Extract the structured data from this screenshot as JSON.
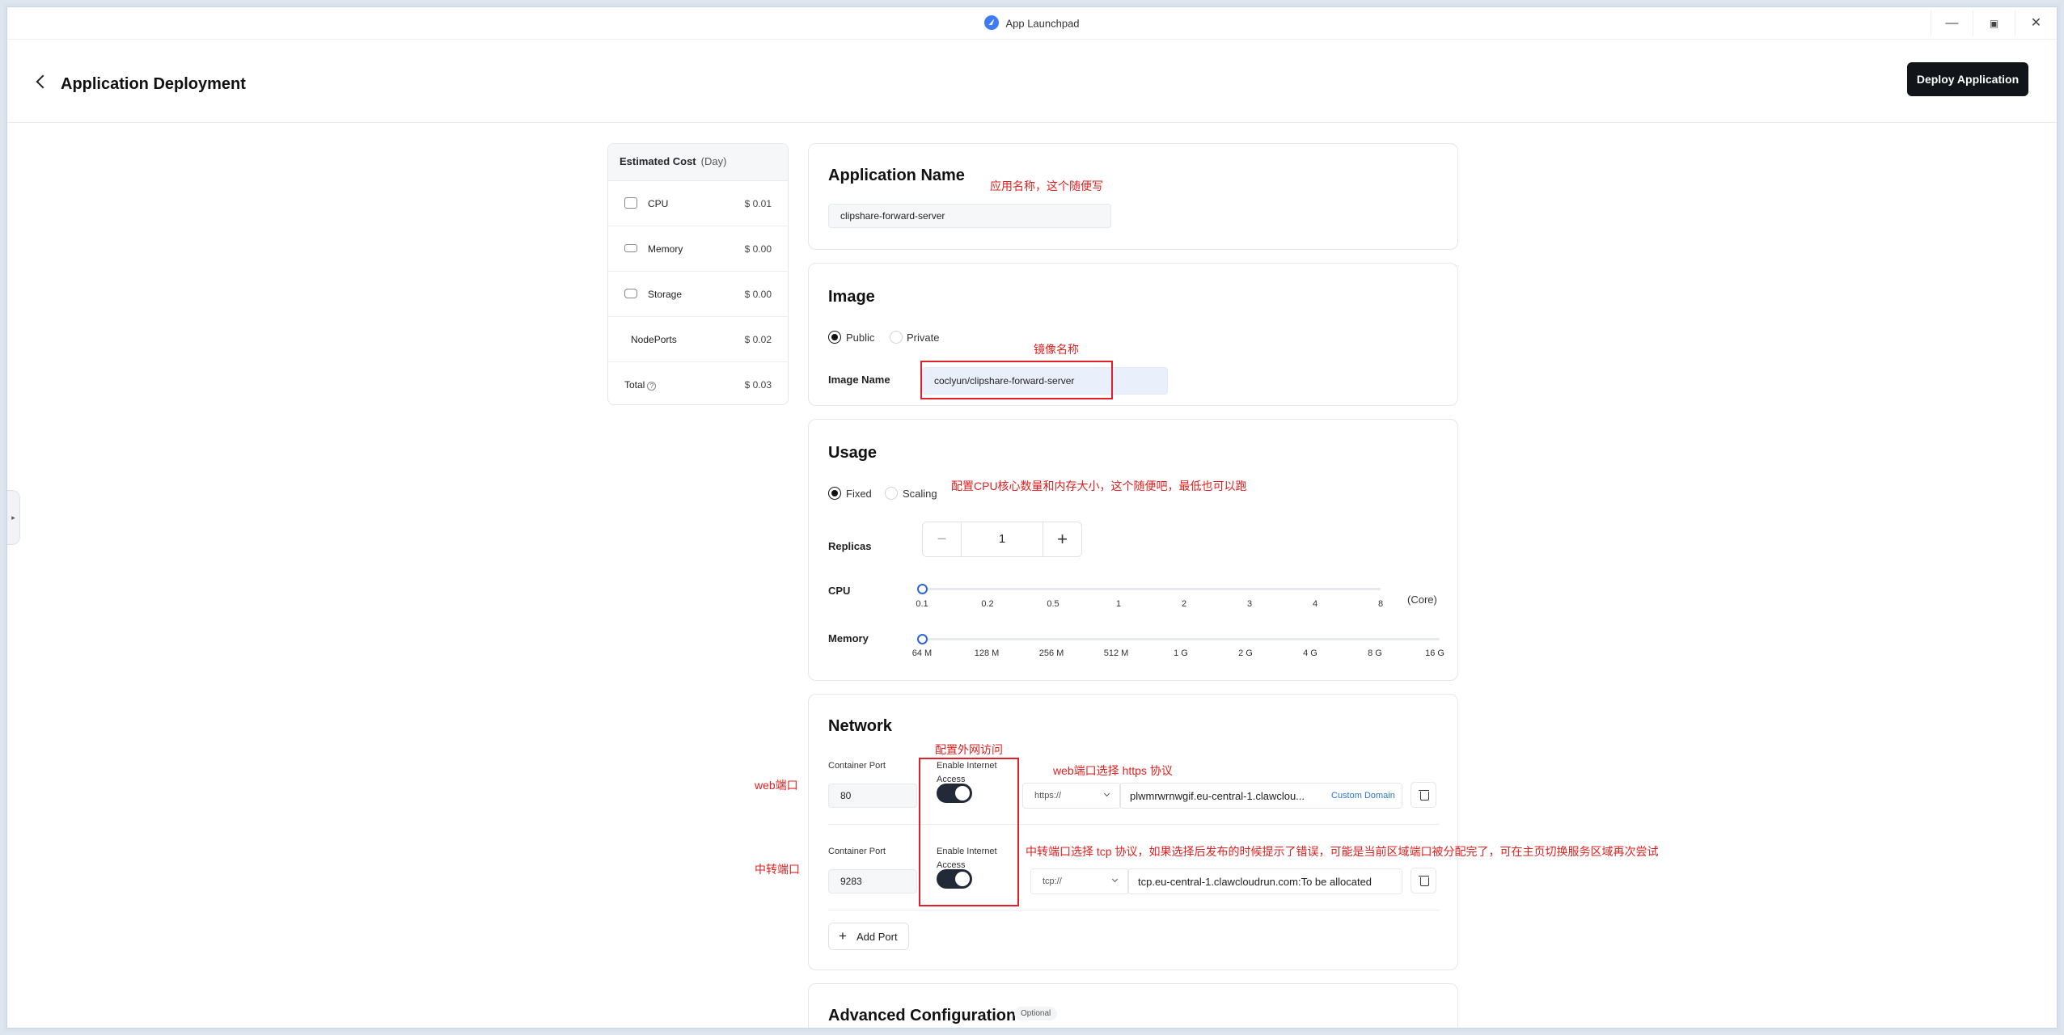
{
  "window": {
    "title": "App Launchpad",
    "controls": {
      "minimize": "—",
      "maximize": "▣",
      "close": "✕"
    }
  },
  "header": {
    "page_title": "Application Deployment",
    "deploy_button": "Deploy Application"
  },
  "cost": {
    "title": "Estimated Cost",
    "period": "(Day)",
    "rows": [
      {
        "label": "CPU",
        "value": "$ 0.01",
        "icon": "cpu-icon"
      },
      {
        "label": "Memory",
        "value": "$ 0.00",
        "icon": "memory-icon"
      },
      {
        "label": "Storage",
        "value": "$ 0.00",
        "icon": "storage-icon"
      },
      {
        "label": "NodePorts",
        "value": "$ 0.02"
      },
      {
        "label": "Total",
        "value": "$ 0.03"
      }
    ]
  },
  "app_name": {
    "title": "Application Name",
    "value": "clipshare-forward-server"
  },
  "image": {
    "title": "Image",
    "option_public": "Public",
    "option_private": "Private",
    "selected": "Public",
    "name_label": "Image Name",
    "name_value": "coclyun/clipshare-forward-server"
  },
  "usage": {
    "title": "Usage",
    "option_fixed": "Fixed",
    "option_scaling": "Scaling",
    "selected": "Fixed",
    "replicas_label": "Replicas",
    "replicas_value": "1",
    "cpu_label": "CPU",
    "cpu_unit": "(Core)",
    "cpu_ticks": [
      "0.1",
      "0.2",
      "0.5",
      "1",
      "2",
      "3",
      "4",
      "8"
    ],
    "cpu_selected": "0.1",
    "memory_label": "Memory",
    "memory_ticks": [
      "64 M",
      "128 M",
      "256 M",
      "512 M",
      "1 G",
      "2 G",
      "4 G",
      "8 G",
      "16 G"
    ],
    "memory_selected": "64 M"
  },
  "network": {
    "title": "Network",
    "ports": [
      {
        "container_port_label": "Container Port",
        "port": "80",
        "internet_label": "Enable Internet Access",
        "internet_enabled": true,
        "protocol": "https://",
        "domain": "plwmrwrnwgif.eu-central-1.clawclou...",
        "custom_domain": "Custom Domain"
      },
      {
        "container_port_label": "Container Port",
        "port": "9283",
        "internet_label": "Enable Internet Access",
        "internet_enabled": true,
        "protocol": "tcp://",
        "domain": "tcp.eu-central-1.clawcloudrun.com:To be allocated"
      }
    ],
    "add_port": "Add Port"
  },
  "advanced": {
    "title": "Advanced Configuration",
    "badge": "Optional"
  },
  "annotations": {
    "app_name": "应用名称，这个随便写",
    "image_name": "镜像名称",
    "usage": "配置CPU核心数量和内存大小，这个随便吧，最低也可以跑",
    "internet": "配置外网访问",
    "web_protocol": "web端口选择 https 协议",
    "web_port": "web端口",
    "tcp_protocol": "中转端口选择 tcp 协议，如果选择后发布的时候提示了错误，可能是当前区域端口被分配完了，可在主页切换服务区域再次尝试",
    "relay_port": "中转端口"
  },
  "colors": {
    "annotation": "#e02020",
    "primary_button": "#111418",
    "slider_accent": "#2f64d6",
    "link": "#2f78d2",
    "toggle_on": "#212a36"
  }
}
